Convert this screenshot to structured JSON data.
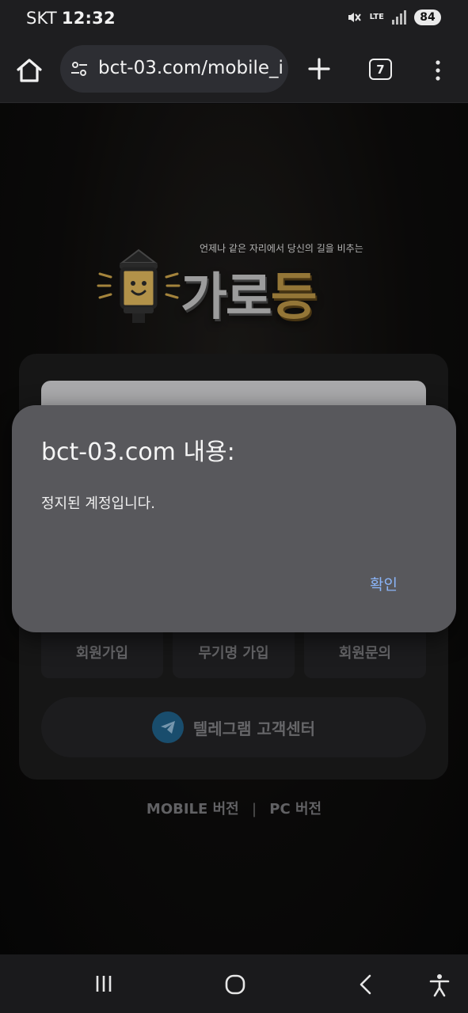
{
  "status_bar": {
    "carrier": "SKT",
    "time": "12:32",
    "network": "LTE",
    "battery": "84"
  },
  "browser": {
    "url": "bct-03.com/mobile_i",
    "tab_count": "7"
  },
  "page": {
    "logo_tagline": "언제나 같은 자리에서 당신의 길을 비추는",
    "logo_main": "가로",
    "logo_accent": "등",
    "links": {
      "signup": "회원가입",
      "anonymous_signup": "무기명 가입",
      "inquiry": "회원문의"
    },
    "telegram_label": "텔레그램 고객센터",
    "footer": {
      "mobile": "MOBILE 버전",
      "separator": "|",
      "pc": "PC 버전"
    }
  },
  "dialog": {
    "title": "bct-03.com 내용:",
    "message": "정지된 계정입니다.",
    "ok_label": "확인"
  },
  "colors": {
    "dialog_bg": "#58585c",
    "ok_accent": "#8ab4f8",
    "logo_gold": "#b59044"
  }
}
